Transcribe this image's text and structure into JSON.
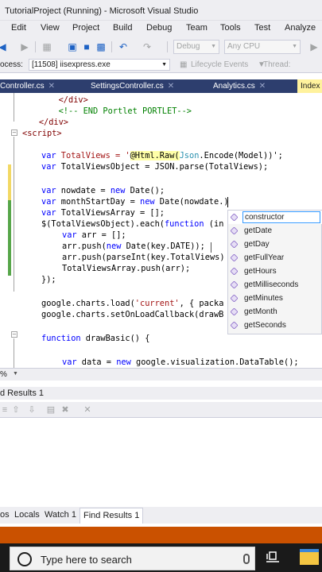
{
  "window": {
    "title": "TutorialProject (Running) - Microsoft Visual Studio"
  },
  "menu": {
    "items": [
      "Edit",
      "View",
      "Project",
      "Build",
      "Debug",
      "Team",
      "Tools",
      "Test",
      "Analyze"
    ]
  },
  "toolbar": {
    "config_combo": "Debug",
    "platform_combo": "Any CPU"
  },
  "process_bar": {
    "label": "ocess:",
    "process_value": "[11508] iisexpress.exe",
    "lifecycle": "Lifecycle Events",
    "thread_label": "Thread:"
  },
  "tabs": [
    {
      "label": "Controller.cs"
    },
    {
      "label": "SettingsController.cs"
    },
    {
      "label": "Analytics.cs"
    },
    {
      "label": "Index"
    }
  ],
  "code": {
    "l01_indent": "        ",
    "l01_tag": "</div>",
    "l02_indent": "        ",
    "l02_cmt": "<!-- END Portlet PORTLET-->",
    "l03_indent": "    ",
    "l03_tag": "</div>",
    "l04_tag": "<script>",
    "l05_kw": "var",
    "l05_a": " TotalViews = '",
    "l05_razor": "@Html.Raw(",
    "l05_type": "Json",
    "l05_b": ".Encode(Model))';",
    "l06_kw": "var",
    "l06_a": " TotalViewsObject = JSON.parse(TotalViews);",
    "l07_kw": "var",
    "l07_a": " nowdate = ",
    "l07_kw2": "new",
    "l07_b": " Date();",
    "l08_kw": "var",
    "l08_a": " monthStartDay = ",
    "l08_kw2": "new",
    "l08_b": " Date(nowdate.)",
    "l09_kw": "var",
    "l09_a": " TotalViewsArray = [];",
    "l10_a": "$(TotalViewsObject).each(",
    "l10_kw": "function",
    "l10_b": " (in",
    "l11_kw": "var",
    "l11_a": " arr = [];",
    "l12_a": "arr.push(",
    "l12_kw": "new",
    "l12_b": " Date(key.DATE));",
    "l13_a": "arr.push(parseInt(key.TotalViews)",
    "l14_a": "TotalViewsArray.push(arr);",
    "l15_a": "});",
    "l16_a": "google.charts.load(",
    "l16_str": "'current'",
    "l16_b": ", { packa",
    "l17_a": "google.charts.setOnLoadCallback(drawB",
    "l18_kw": "function",
    "l18_a": " drawBasic() {",
    "l19_kw": "var",
    "l19_a": " data = ",
    "l19_kw2": "new",
    "l19_b": " google.visualization.DataTable();"
  },
  "intellisense": {
    "items": [
      "constructor",
      "getDate",
      "getDay",
      "getFullYear",
      "getHours",
      "getMilliseconds",
      "getMinutes",
      "getMonth",
      "getSeconds"
    ],
    "selected": "constructor"
  },
  "editor_status": {
    "zoom": "%"
  },
  "find_panel": {
    "title": "d Results 1"
  },
  "bottom_tabs": {
    "items": [
      "os",
      "Locals",
      "Watch 1",
      "Find Results 1"
    ],
    "active": "Find Results 1"
  },
  "taskbar": {
    "search_placeholder": "Type here to search"
  },
  "colors": {
    "tab_strip": "#2d3e6e",
    "active_tab": "#fff29d",
    "status_bar_debug": "#ca5100",
    "keyword": "#0000ff",
    "comment": "#008000",
    "string": "#a31515",
    "tag": "#800000"
  }
}
